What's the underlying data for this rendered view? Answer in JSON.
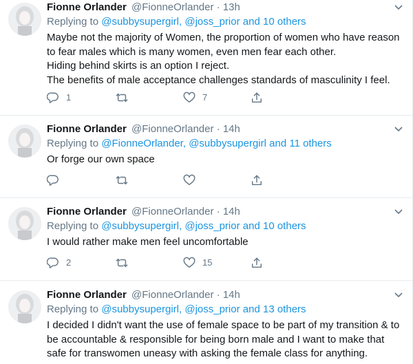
{
  "colors": {
    "accent": "#1b95e0",
    "muted": "#657786",
    "text": "#14171a"
  },
  "tweets": [
    {
      "name": "Fionne Orlander",
      "handle": "@FionneOrlander",
      "dot": "·",
      "time": "13h",
      "replying_prefix": "Replying to",
      "mention1": "@subbysupergirl,",
      "mention2": "@joss_prior",
      "others_joiner": "and",
      "others": "10 others",
      "lines": [
        "Maybe not the majority of Women, the proportion of women who have reason",
        "to fear males which is many women, even men fear each other.",
        "Hiding behind skirts is an option I reject.",
        "The benefits of male acceptance challenges standards of masculinity I feel."
      ],
      "reply_count": "1",
      "retweet_count": "",
      "like_count": "7"
    },
    {
      "name": "Fionne Orlander",
      "handle": "@FionneOrlander",
      "dot": "·",
      "time": "14h",
      "replying_prefix": "Replying to",
      "mention1": "@FionneOrlander,",
      "mention2": "@subbysupergirl",
      "others_joiner": "and",
      "others": "11 others",
      "lines": [
        "Or forge our own space"
      ],
      "reply_count": "",
      "retweet_count": "",
      "like_count": ""
    },
    {
      "name": "Fionne Orlander",
      "handle": "@FionneOrlander",
      "dot": "·",
      "time": "14h",
      "replying_prefix": "Replying to",
      "mention1": "@subbysupergirl,",
      "mention2": "@joss_prior",
      "others_joiner": "and",
      "others": "10 others",
      "lines": [
        "I would rather make men feel uncomfortable"
      ],
      "reply_count": "2",
      "retweet_count": "",
      "like_count": "15"
    },
    {
      "name": "Fionne Orlander",
      "handle": "@FionneOrlander",
      "dot": "·",
      "time": "14h",
      "replying_prefix": "Replying to",
      "mention1": "@subbysupergirl,",
      "mention2": "@joss_prior",
      "others_joiner": "and",
      "others": "13 others",
      "lines": [
        "I decided I didn't want the use of female space to be part of my transition & to",
        "be accountable & responsible for being born male and I want to make that",
        "safe for transwomen uneasy with asking the female class for anything."
      ],
      "reply_count": "",
      "retweet_count": "",
      "like_count": ""
    }
  ]
}
